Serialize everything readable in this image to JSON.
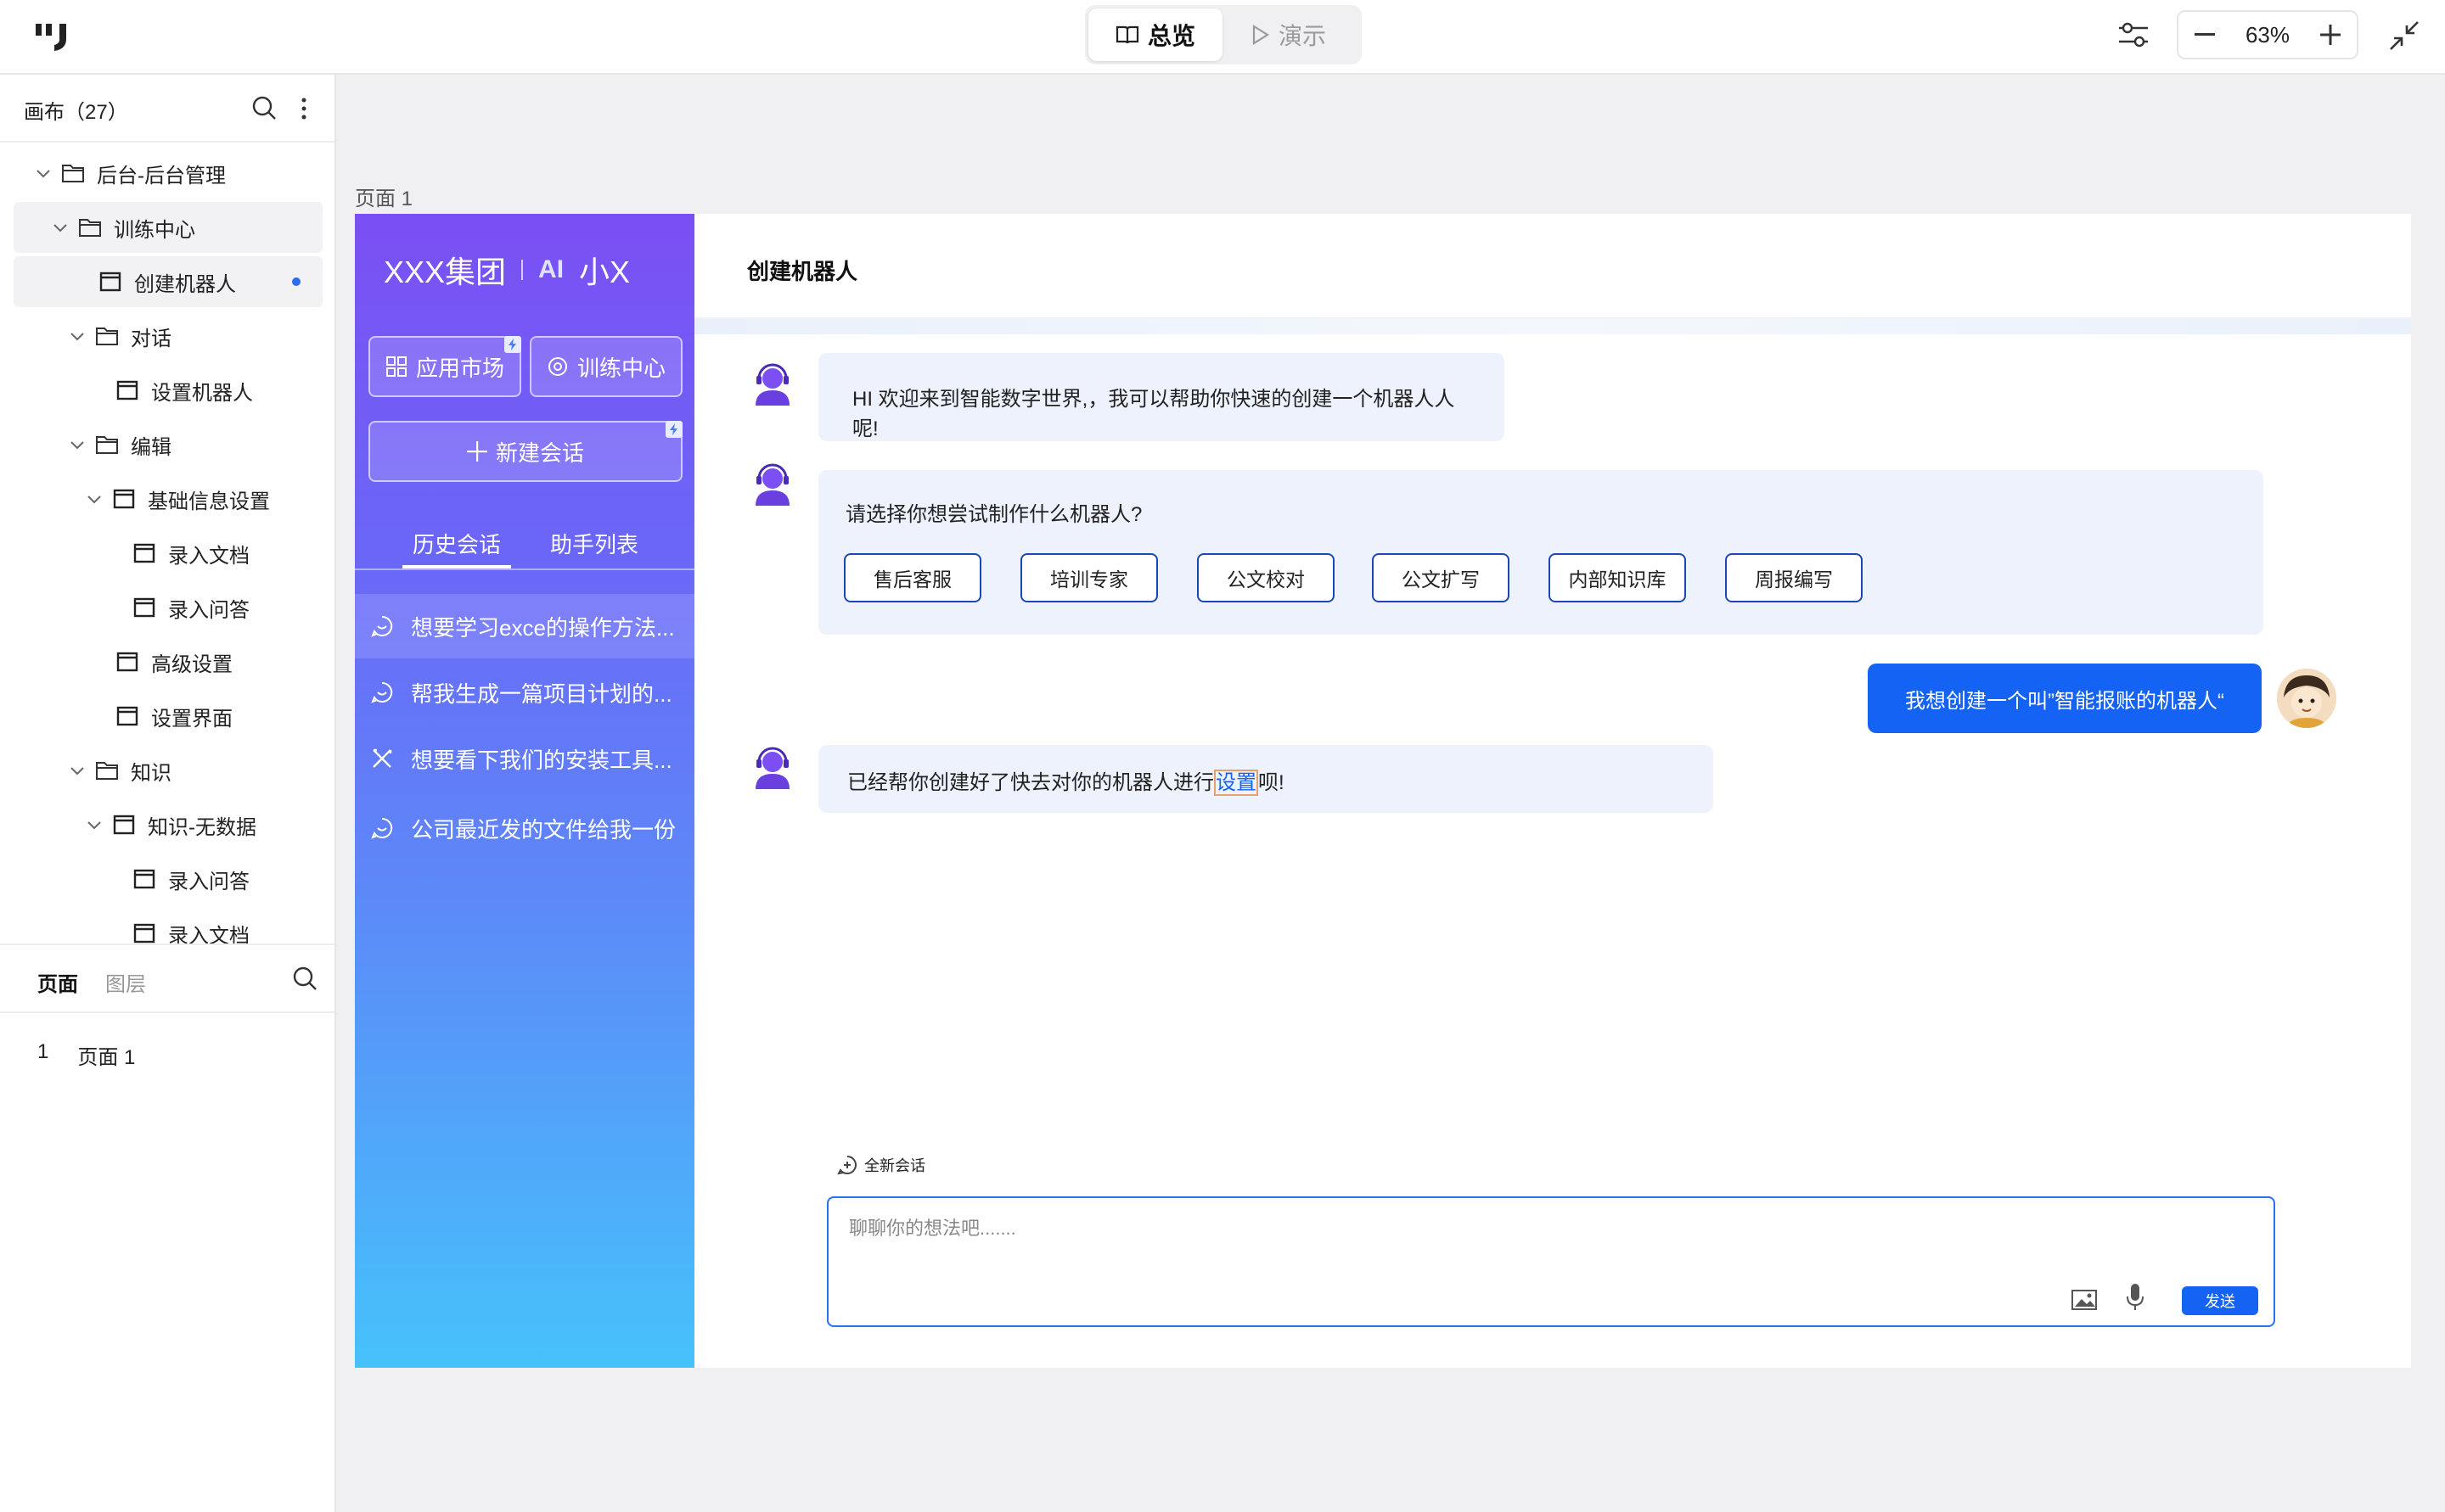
{
  "topbar": {
    "tab_overview": "总览",
    "tab_present": "演示",
    "zoom_value": "63%"
  },
  "left_panel": {
    "canvas_title": "画布（27）",
    "tree": [
      {
        "label": "后台-后台管理",
        "type": "folder"
      },
      {
        "label": "训练中心",
        "type": "folder"
      },
      {
        "label": "创建机器人",
        "type": "page"
      },
      {
        "label": "对话",
        "type": "folder"
      },
      {
        "label": "设置机器人",
        "type": "page"
      },
      {
        "label": "编辑",
        "type": "folder"
      },
      {
        "label": "基础信息设置",
        "type": "page"
      },
      {
        "label": "录入文档",
        "type": "page"
      },
      {
        "label": "录入问答",
        "type": "page"
      },
      {
        "label": "高级设置",
        "type": "page"
      },
      {
        "label": "设置界面",
        "type": "page"
      },
      {
        "label": "知识",
        "type": "folder"
      },
      {
        "label": "知识-无数据",
        "type": "page"
      },
      {
        "label": "录入问答",
        "type": "page"
      },
      {
        "label": "录入文档",
        "type": "page"
      }
    ],
    "tab_pages": "页面",
    "tab_layers": "图层",
    "page_index": "1",
    "page_name": "页面 1"
  },
  "canvas": {
    "page_label": "页面 1",
    "brand_name": "XXX集团",
    "ai_badge": "AI",
    "assistant_name": "小X",
    "btn_app_market": "应用市场",
    "btn_training": "训练中心",
    "btn_new_chat": "新建会话",
    "tab_history": "历史会话",
    "tab_assistants": "助手列表",
    "history": [
      "想要学习exce的操作方法...",
      "帮我生成一篇项目计划的...",
      "想要看下我们的安装工具...",
      "公司最近发的文件给我一份"
    ],
    "main_title": "创建机器人",
    "msg_greeting": "HI  欢迎来到智能数字世界,，我可以帮助你快速的创建一个机器人人呢!",
    "msg_question": "请选择你想尝试制作什么机器人?",
    "options": [
      "售后客服",
      "培训专家",
      "公文校对",
      "公文扩写",
      "内部知识库",
      "周报编写"
    ],
    "msg_user": "我想创建一个叫”智能报账的机器人“",
    "msg_done_prefix": "已经帮你创建好了快去对你的机器人进行",
    "msg_done_link": "设置",
    "msg_done_suffix": "呗!",
    "new_session": "全新会话",
    "input_placeholder": "聊聊你的想法吧.......",
    "send_label": "发送"
  },
  "colors": {
    "accent_blue": "#1463f5",
    "sidebar_top": "#7b4ff4",
    "sidebar_bottom": "#46c2fb"
  }
}
